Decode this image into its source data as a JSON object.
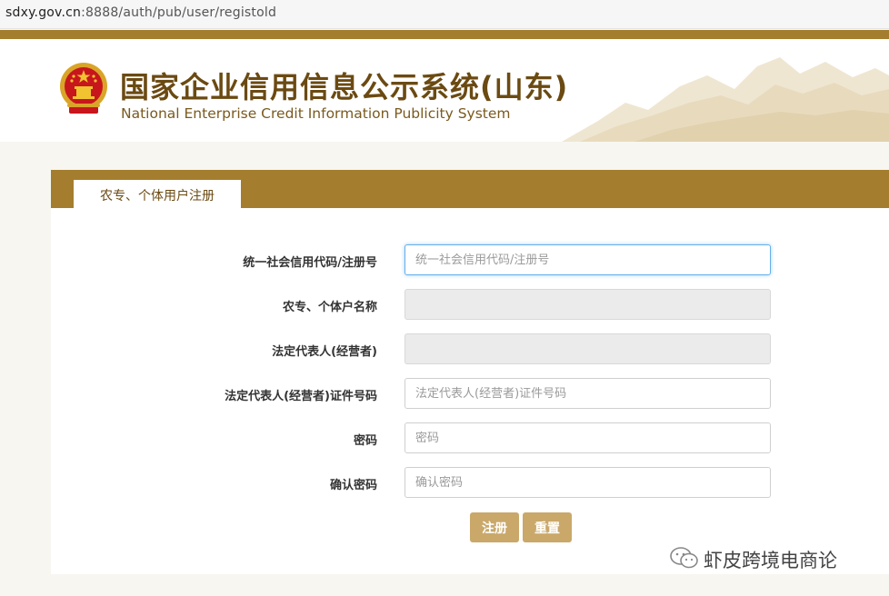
{
  "browser": {
    "url_host": "sdxy.gov.cn",
    "url_path": ":8888/auth/pub/user/registold"
  },
  "header": {
    "title_cn": "国家企业信用信息公示系统(山东)",
    "title_en": "National Enterprise Credit Information Publicity System"
  },
  "tab": {
    "label": "农专、个体用户注册"
  },
  "form": {
    "fields": [
      {
        "label": "统一社会信用代码/注册号",
        "placeholder": "统一社会信用代码/注册号",
        "value": ""
      },
      {
        "label": "农专、个体户名称",
        "placeholder": "",
        "value": ""
      },
      {
        "label": "法定代表人(经营者)",
        "placeholder": "",
        "value": ""
      },
      {
        "label": "法定代表人(经营者)证件号码",
        "placeholder": "法定代表人(经营者)证件号码",
        "value": ""
      },
      {
        "label": "密码",
        "placeholder": "密码",
        "value": ""
      },
      {
        "label": "确认密码",
        "placeholder": "确认密码",
        "value": ""
      }
    ],
    "register_label": "注册",
    "reset_label": "重置"
  },
  "watermark": {
    "text": "虾皮跨境电商论"
  },
  "colors": {
    "brand_gold": "#a47e2e",
    "title_brown": "#6b4a12",
    "button": "#c9a86a",
    "focus": "#66afe9"
  }
}
